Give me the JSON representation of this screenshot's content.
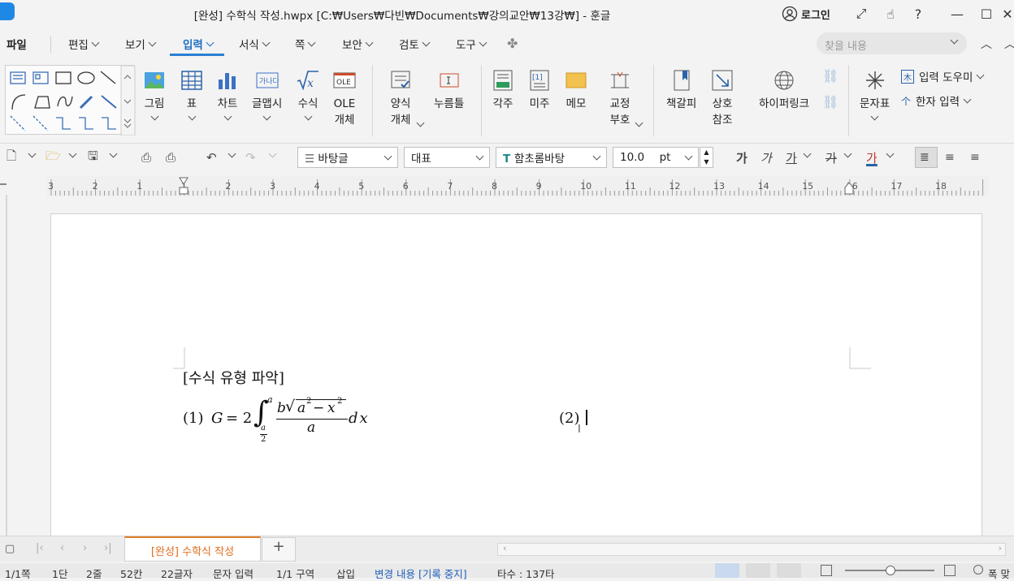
{
  "window": {
    "title": "[완성] 수학식 작성.hwpx [C:₩Users₩다빈₩Documents₩강의교안₩13강₩] - 훈글",
    "login_label": "로그인"
  },
  "menu": {
    "items": [
      "파일",
      "편집",
      "보기",
      "입력",
      "서식",
      "쪽",
      "보안",
      "검토",
      "도구"
    ],
    "active": "입력",
    "search_placeholder": "찾을 내용"
  },
  "ribbon": {
    "insert_buttons": [
      {
        "label": "그림",
        "icon": "picture-icon"
      },
      {
        "label": "표",
        "icon": "table-icon"
      },
      {
        "label": "차트",
        "icon": "chart-icon"
      },
      {
        "label": "글맵시",
        "icon": "textart-icon"
      },
      {
        "label": "수식",
        "icon": "equation-icon"
      },
      {
        "label": "OLE\n개체",
        "icon": "ole-icon"
      }
    ],
    "form_buttons": [
      {
        "label": "양식\n개체",
        "icon": "form-object-icon"
      },
      {
        "label": "누름틀",
        "icon": "field-icon"
      }
    ],
    "note_buttons": [
      {
        "label": "각주",
        "icon": "footnote-icon"
      },
      {
        "label": "미주",
        "icon": "endnote-icon"
      },
      {
        "label": "메모",
        "icon": "memo-icon"
      },
      {
        "label": "교정\n부호",
        "icon": "proofread-icon"
      }
    ],
    "link_buttons": [
      {
        "label": "책갈피",
        "icon": "bookmark-icon"
      },
      {
        "label": "상호\n참조",
        "icon": "crossref-icon"
      },
      {
        "label": "하이퍼링크",
        "icon": "hyperlink-icon"
      }
    ],
    "char_button": "문자표",
    "input_helper": "입력 도우미",
    "hanja_input": "한자 입력",
    "ole_icon_text": "OLE"
  },
  "toolbar": {
    "style": "바탕글",
    "representative": "대표",
    "font": "함초롬바탕",
    "size": "10.0",
    "unit": "pt",
    "bold": "가",
    "italic": "가",
    "underline": "가",
    "strike": "가",
    "color": "가"
  },
  "ruler": {
    "ticks": [
      "3",
      "2",
      "1",
      "1",
      "2",
      "3",
      "4",
      "5",
      "6",
      "7",
      "8",
      "9",
      "10",
      "11",
      "12",
      "13",
      "14",
      "15",
      "16",
      "17",
      "18"
    ]
  },
  "document": {
    "heading": "[수식 유형 파악]",
    "item1_label": "(1)",
    "item2_label": "(2)",
    "eq": {
      "G": "G",
      "equals": "= 2",
      "integral": "∫",
      "upper": "a",
      "lower_num": "a",
      "lower_den": "2",
      "b": "b",
      "sqrt": "√",
      "a2": "a",
      "minus": "−",
      "x2": "x",
      "sup": "2",
      "denominator": "a",
      "dx": "dx"
    }
  },
  "tabs": {
    "doc_tab": "[완성] 수학식 작성",
    "add": "+"
  },
  "status": {
    "page": "1/1쪽",
    "column": "1단",
    "line": "2줄",
    "col": "52칸",
    "chars": "22글자",
    "mode": "문자 입력",
    "section": "1/1 구역",
    "insert": "삽입",
    "track": "변경 내용 [기록 중지]",
    "stroke": "타수 : 137타",
    "zoom_label": "폭 맞"
  },
  "colors": {
    "accent": "#2a7fd4",
    "tab_accent": "#e07f25",
    "track_text": "#1f5fbf"
  }
}
